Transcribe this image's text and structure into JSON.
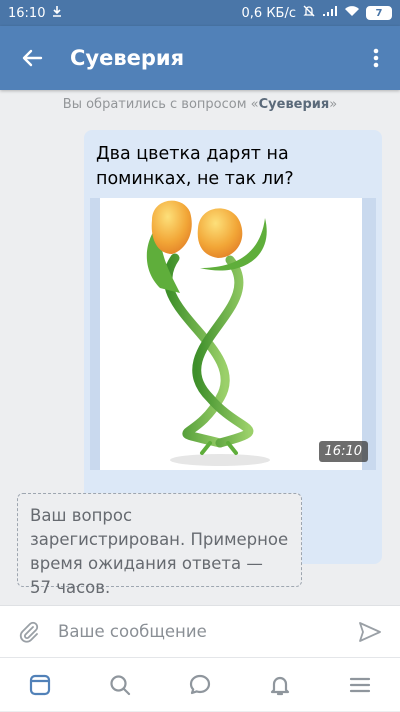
{
  "status": {
    "time": "16:10",
    "speed": "0,6 КБ/с",
    "battery": "7"
  },
  "header": {
    "title": "Суеверия"
  },
  "system_message": {
    "prefix": "Вы обратились с вопросом «",
    "topic": "Суеверия",
    "suffix": "»"
  },
  "message": {
    "text": "Два цветка дарят на поминках, не так ли?",
    "time": "16:10"
  },
  "reply": {
    "text": "Ваш вопрос зарегистрирован. Примерное время ожидания ответа — 57 часов."
  },
  "composer": {
    "placeholder": "Ваше сообщение"
  },
  "colors": {
    "statusbar": "#4a76a8",
    "appbar": "#5181b8",
    "bubble": "#dce8f7",
    "accent": "#5181b8"
  }
}
